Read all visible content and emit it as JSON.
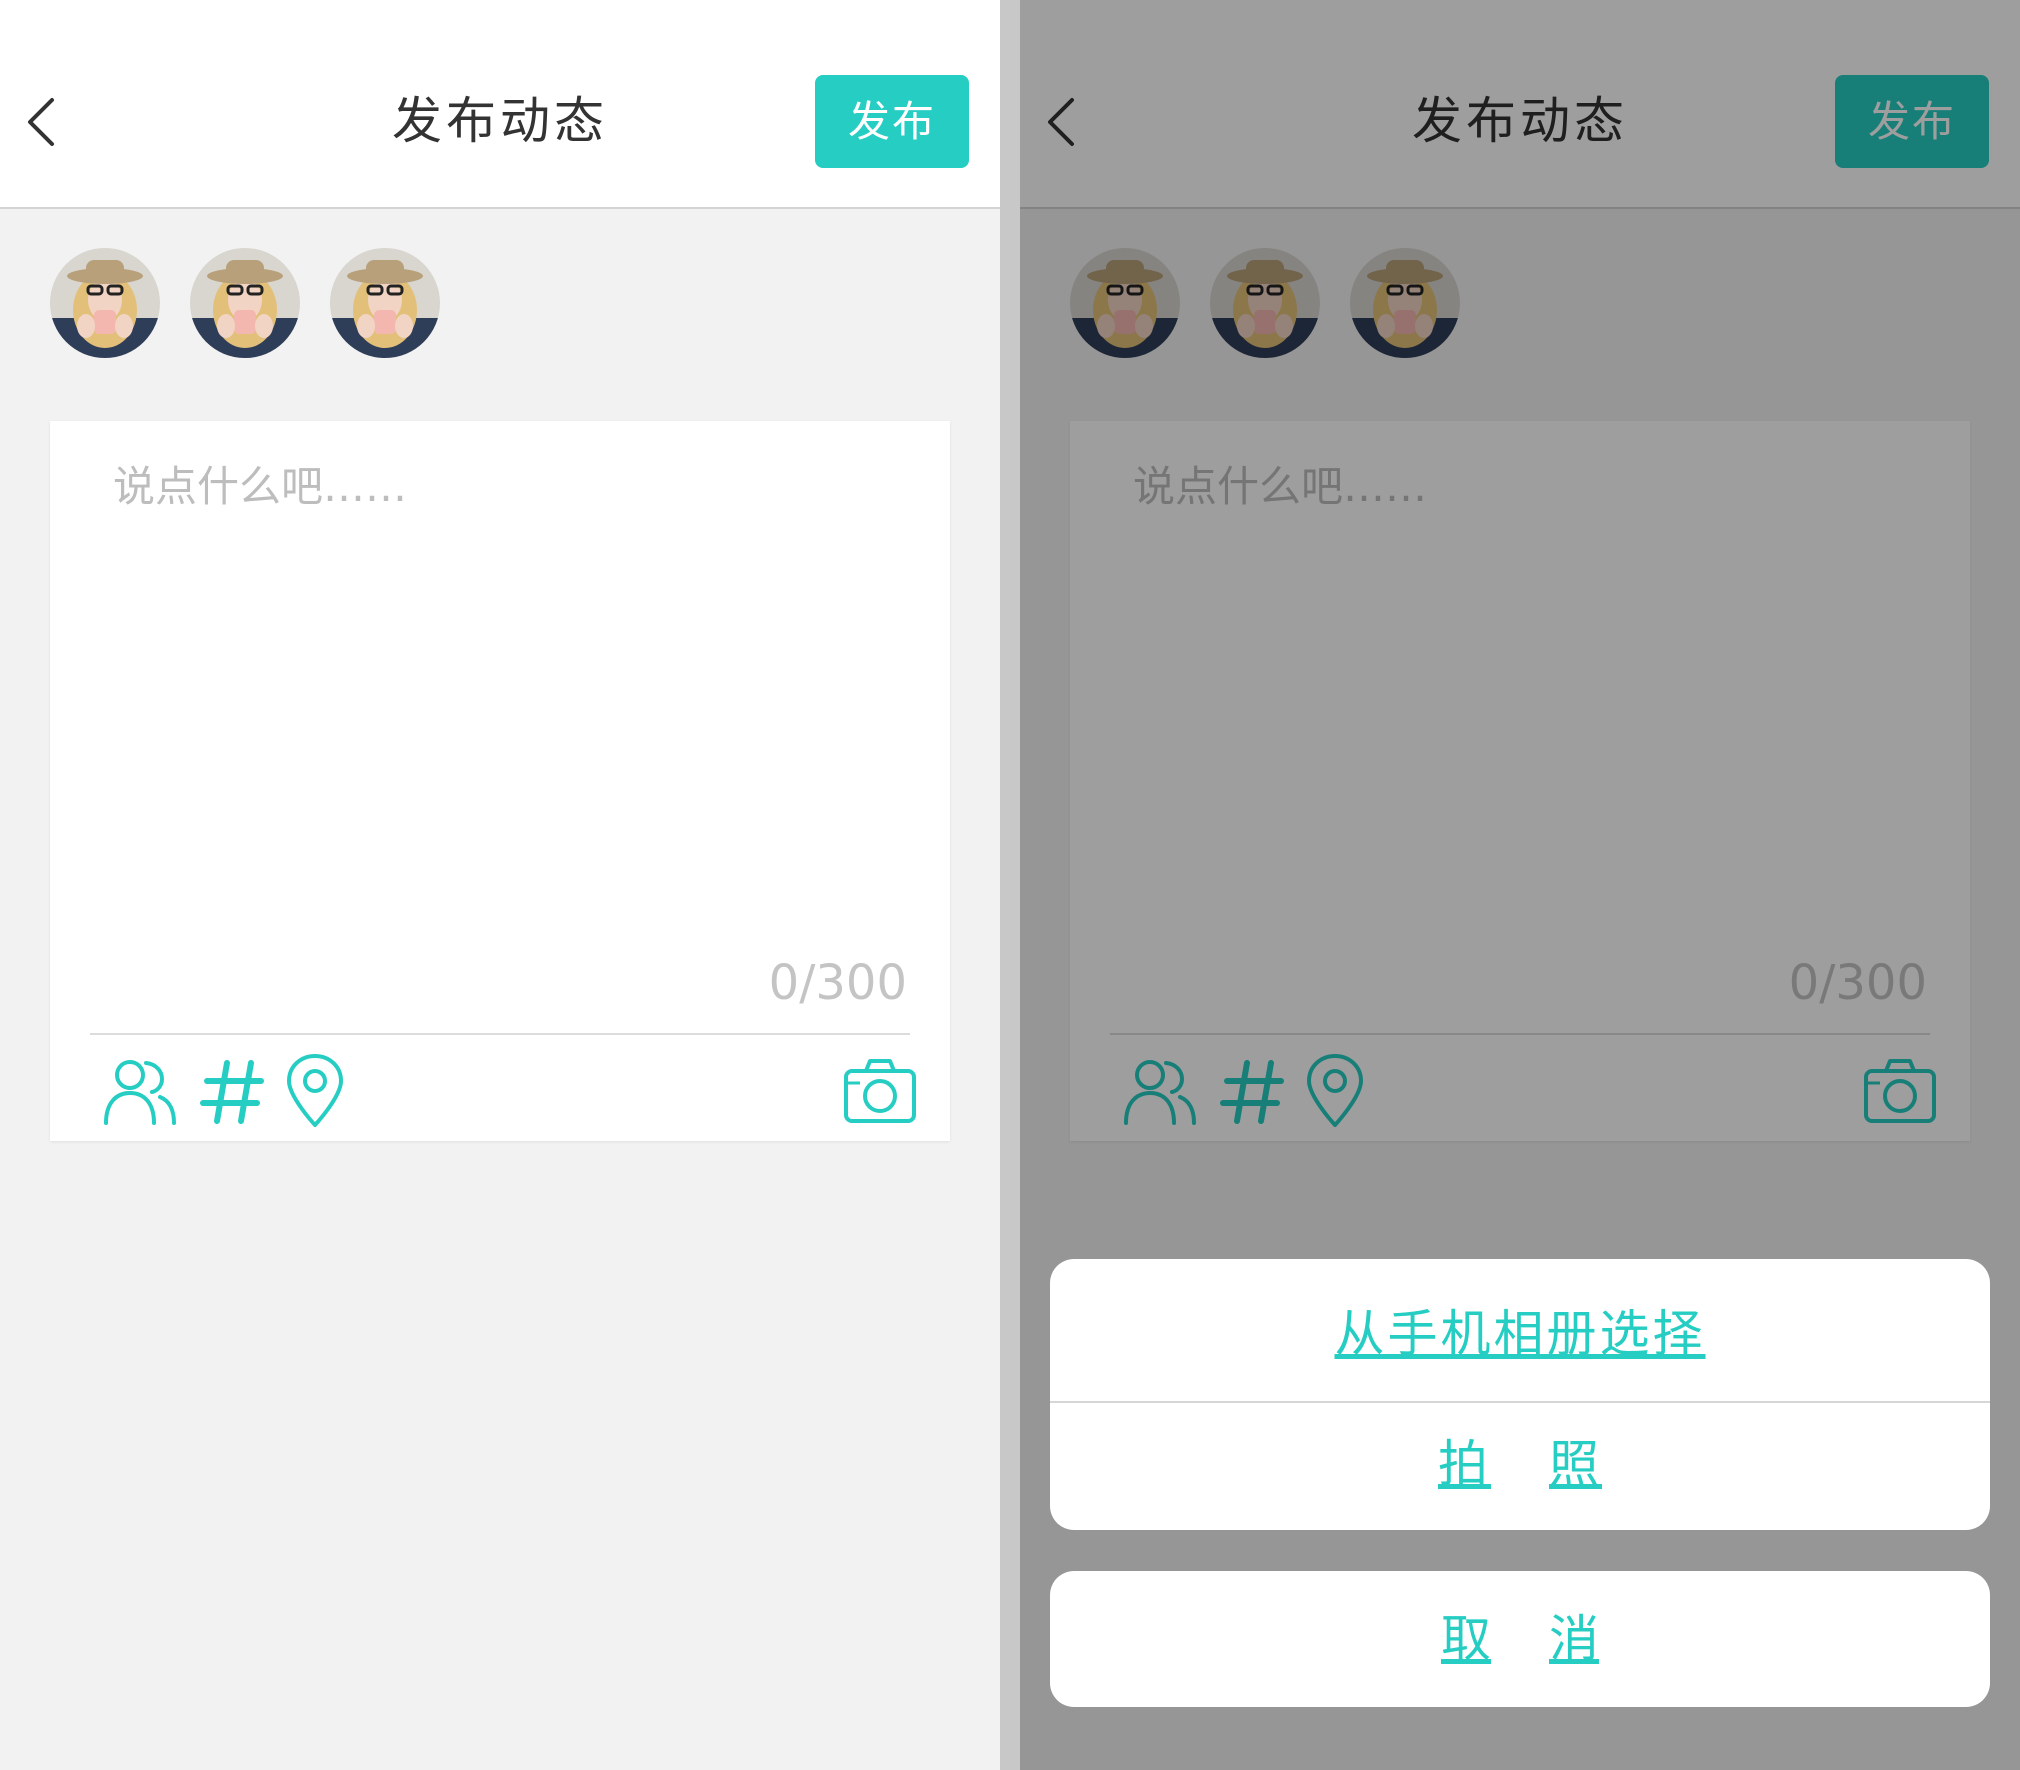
{
  "colors": {
    "accent": "#26cdc2",
    "background": "#f2f2f2",
    "overlay": "rgba(0,0,0,0.38)"
  },
  "header": {
    "title": "发布动态",
    "publish_label": "发布"
  },
  "compose": {
    "placeholder": "说点什么吧……",
    "counter": "0/300"
  },
  "toolbar_icons": [
    "users-icon",
    "hashtag-icon",
    "location-pin-icon",
    "camera-icon"
  ],
  "avatars": [
    "avatar-1",
    "avatar-2",
    "avatar-3"
  ],
  "action_sheet": {
    "choose_from_album": "从手机相册选择",
    "take_photo": [
      "拍",
      "照"
    ],
    "cancel": [
      "取",
      "消"
    ]
  }
}
